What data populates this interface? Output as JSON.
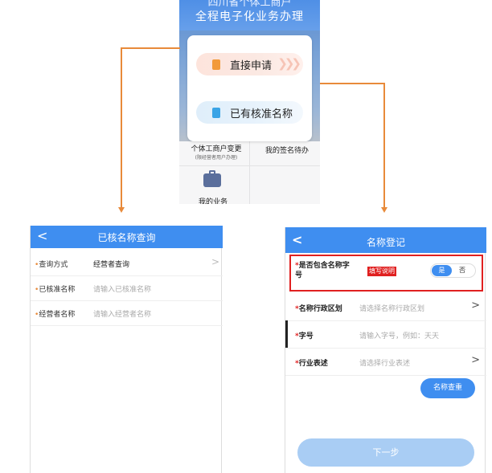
{
  "top_screen": {
    "title_line1": "四川省个体工商户",
    "title_line2": "全程电子化业务办理",
    "popup": {
      "direct_apply": "直接申请",
      "approved_name": "已有核准名称"
    },
    "grid": {
      "change": "个体工商户变更",
      "change_note": "(限经营者用户办理)",
      "sign_pending": "我的签名待办",
      "my_business": "我的业务"
    }
  },
  "left_screen": {
    "back": "<",
    "title": "已核名称查询",
    "rows": [
      {
        "star": "•",
        "label": "查询方式",
        "value": "经营者查询",
        "chevron": ">"
      },
      {
        "star": "•",
        "label": "已核准名称",
        "placeholder": "请输入已核准名称"
      },
      {
        "star": "•",
        "label": "经营者名称",
        "placeholder": "请输入经营者名称"
      }
    ]
  },
  "right_screen": {
    "back": "<",
    "title": "名称登记",
    "row1": {
      "star": "*",
      "label": "是否包含名称字号",
      "tag": "填写说明",
      "yes": "是",
      "no": "否"
    },
    "row2": {
      "star": "*",
      "label": "名称行政区划",
      "placeholder": "请选择名称行政区划",
      "chevron": ">"
    },
    "row3": {
      "star": "*",
      "label": "字号",
      "placeholder": "请输入字号，例如：天天"
    },
    "row4": {
      "star": "*",
      "label": "行业表述",
      "placeholder": "请选择行业表述",
      "chevron": ">"
    },
    "name_check": "名称查重",
    "next": "下一步"
  },
  "colors": {
    "header_blue": "#3f8ef0",
    "connector_orange": "#e88a3a",
    "highlight_red": "#e02020"
  }
}
